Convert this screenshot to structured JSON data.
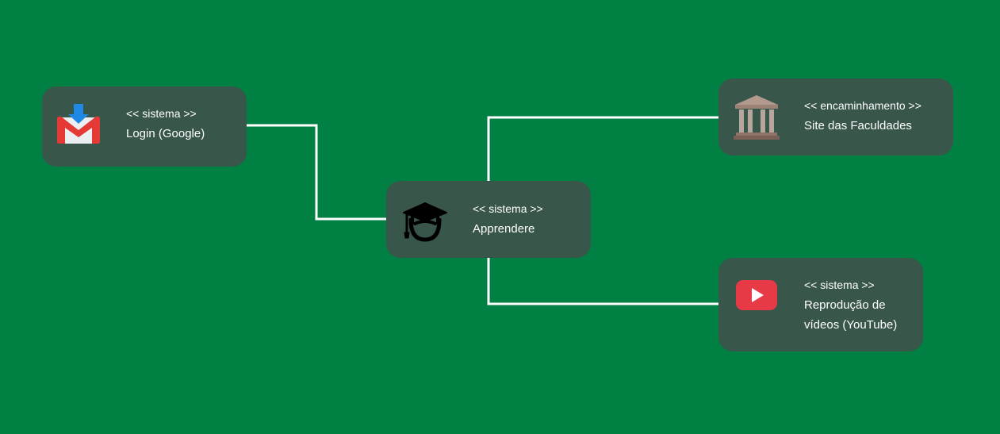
{
  "colors": {
    "background": "#008042",
    "node_fill": "#38564A",
    "connector": "#FFFFFF",
    "text": "#FFFFFF",
    "gmail_red": "#E53935",
    "gmail_arrow": "#1E88E5",
    "youtube_red": "#E83A46",
    "building": "#A08679"
  },
  "nodes": {
    "login": {
      "icon": "gmail-icon",
      "stereotype": "<< sistema >>",
      "label": "Login (Google)"
    },
    "apprendere": {
      "icon": "graduate-icon",
      "stereotype": "<< sistema >>",
      "label": "Apprendere"
    },
    "faculdades": {
      "icon": "institution-icon",
      "stereotype": "<< encaminhamento >>",
      "label": "Site das Faculdades"
    },
    "youtube": {
      "icon": "youtube-icon",
      "stereotype": "<< sistema >>",
      "label_line1": "Reprodução de",
      "label_line2": "vídeos (YouTube)"
    }
  },
  "connections": [
    {
      "from": "login",
      "to": "apprendere"
    },
    {
      "from": "apprendere",
      "to": "faculdades"
    },
    {
      "from": "apprendere",
      "to": "youtube"
    }
  ]
}
